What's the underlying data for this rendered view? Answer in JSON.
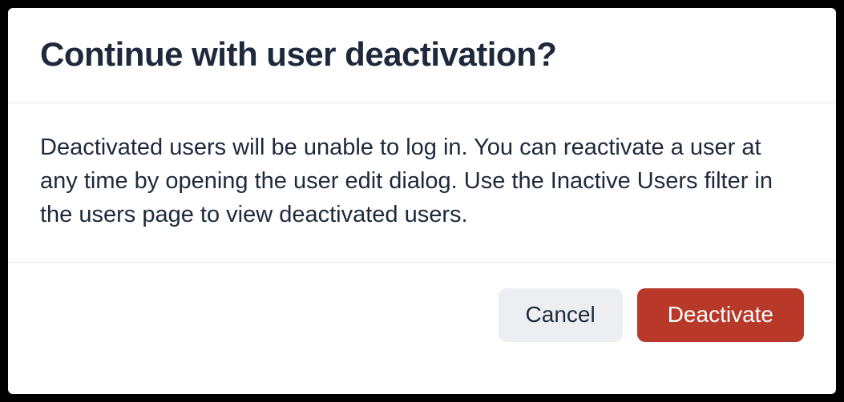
{
  "dialog": {
    "title": "Continue with user deactivation?",
    "body": "Deactivated users will be unable to log in. You can reactivate a user at any time by opening the user edit dialog. Use the Inactive Users filter in the users page to view deactivated users.",
    "actions": {
      "cancel": "Cancel",
      "confirm": "Deactivate"
    }
  }
}
